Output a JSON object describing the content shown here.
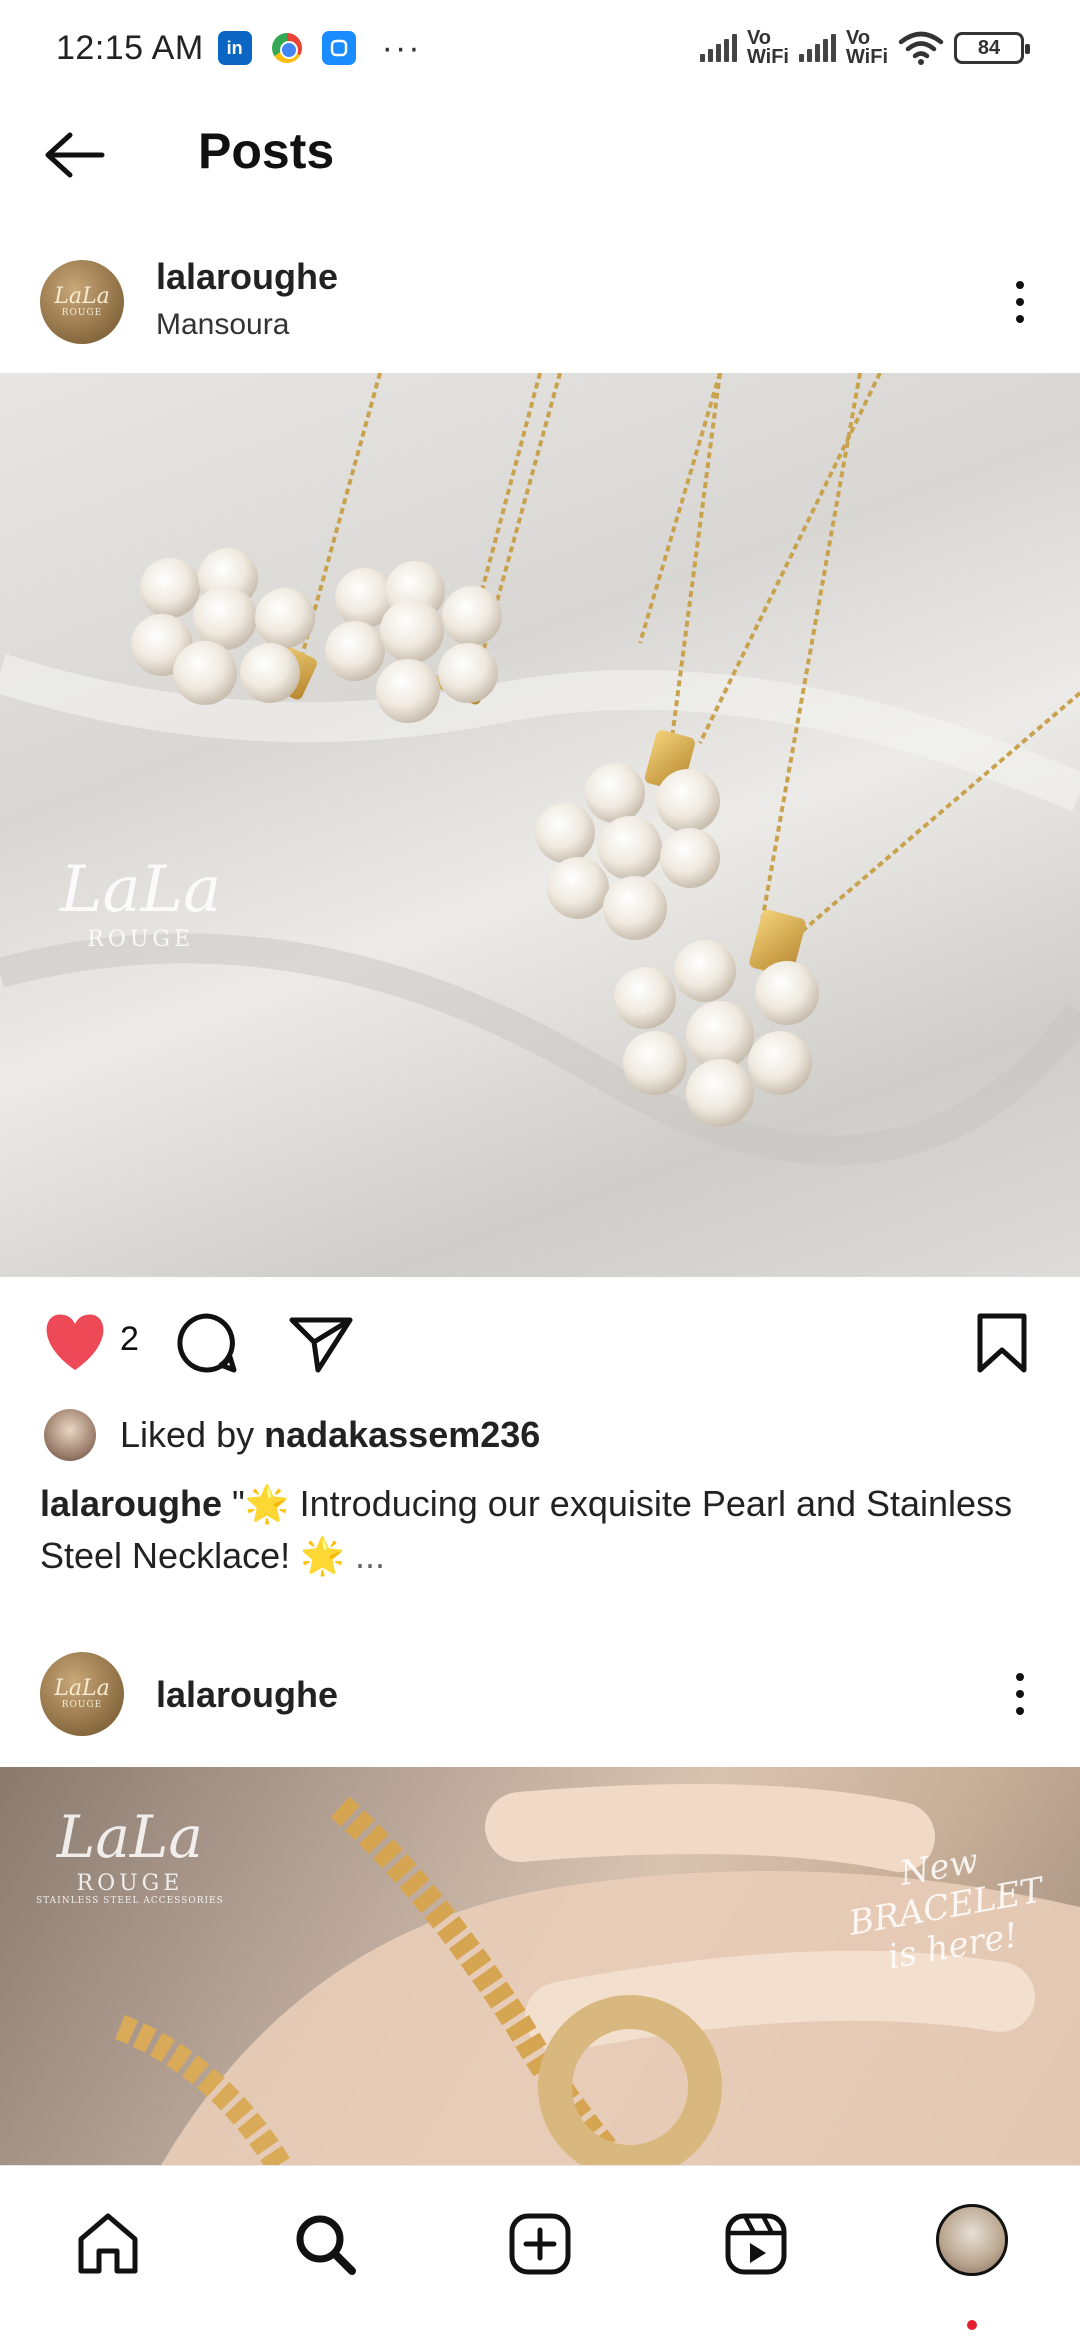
{
  "status_bar": {
    "time": "12:15 AM",
    "more": "···",
    "network_1": "Vo\nWiFi",
    "network_2": "Vo\nWiFi",
    "battery": "84",
    "icons": [
      "linkedin-icon",
      "chrome-icon",
      "messenger-icon",
      "signal-icon",
      "wifi-icon",
      "battery-icon"
    ]
  },
  "header": {
    "title": "Posts",
    "back_icon": "arrow-left-icon"
  },
  "posts": [
    {
      "username": "lalaroughe",
      "location": "Mansoura",
      "avatar_text": "LaLa",
      "avatar_sub": "ROUGE",
      "image_watermark": "LaLa",
      "image_watermark_sub": "ROUGE",
      "like_count": "2",
      "liked_by_prefix": "Liked by ",
      "liked_by_user": "nadakassem236",
      "caption_user": "lalaroughe",
      "caption_text": " \"🌟 Introducing our exquisite Pearl and Stainless Steel Necklace! 🌟 ",
      "caption_more": "..."
    },
    {
      "username": "lalaroughe",
      "avatar_text": "LaLa",
      "avatar_sub": "ROUGE",
      "image_watermark": "LaLa",
      "image_watermark_sub": "ROUGE",
      "image_watermark_tag": "STAINLESS STEEL ACCESSORIES",
      "image_overlay": "New BRACELET is here!"
    }
  ],
  "bottom_nav": {
    "items": [
      "home-icon",
      "search-icon",
      "create-post-icon",
      "reels-icon",
      "profile-avatar"
    ]
  },
  "colors": {
    "like_red": "#ed4956",
    "text": "#111111",
    "notification": "#e5202e"
  }
}
